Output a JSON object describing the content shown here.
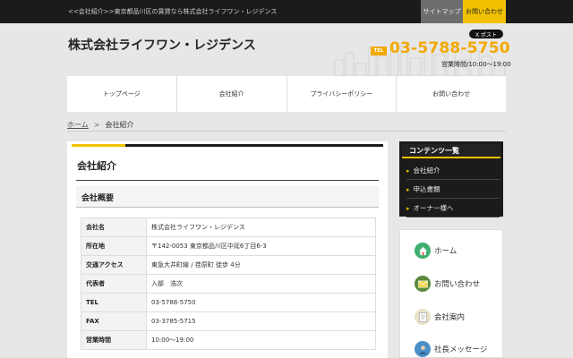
{
  "topbar": {
    "text": "<<会社紹介>>東京都品川区の賃貸なら株式会社ライフワン・レジデンス",
    "sitemap": "サイトマップ",
    "contact": "お問い合わせ"
  },
  "header": {
    "title": "株式会社ライフワン・レジデンス",
    "xpost": "X ポスト",
    "tel_badge": "TEL",
    "tel": "03-5788-5750",
    "hours": "営業時間/10:00～19:00"
  },
  "nav": [
    "トップページ",
    "会社紹介",
    "プライバシーポリシー",
    "お問い合わせ"
  ],
  "breadcrumb": {
    "home": "ホーム",
    "sep": ">",
    "current": "会社紹介"
  },
  "main": {
    "title": "会社紹介",
    "section": "会社概要",
    "rows": [
      {
        "k": "会社名",
        "v": "株式会社ライフワン・レジデンス"
      },
      {
        "k": "所在地",
        "v": "〒142-0053 東京都品川区中延6丁目6-3"
      },
      {
        "k": "交通アクセス",
        "v": "東急大井町線 / 荏原町 徒歩 4分"
      },
      {
        "k": "代表者",
        "v": "入部　浩次"
      },
      {
        "k": "TEL",
        "v": "03-5788-5750"
      },
      {
        "k": "FAX",
        "v": "03-3785-5715"
      },
      {
        "k": "営業時間",
        "v": "10:00～19:00"
      }
    ]
  },
  "sidebar": {
    "heading": "コンテンツ一覧",
    "items": [
      "会社紹介",
      "申込書類",
      "オーナー様へ"
    ],
    "links": [
      "ホーム",
      "お問い合わせ",
      "会社案内",
      "社長メッセージ"
    ]
  },
  "colors": {
    "accent": "#f2c200",
    "tel": "#f2a900",
    "dark": "#1b1b1b"
  }
}
